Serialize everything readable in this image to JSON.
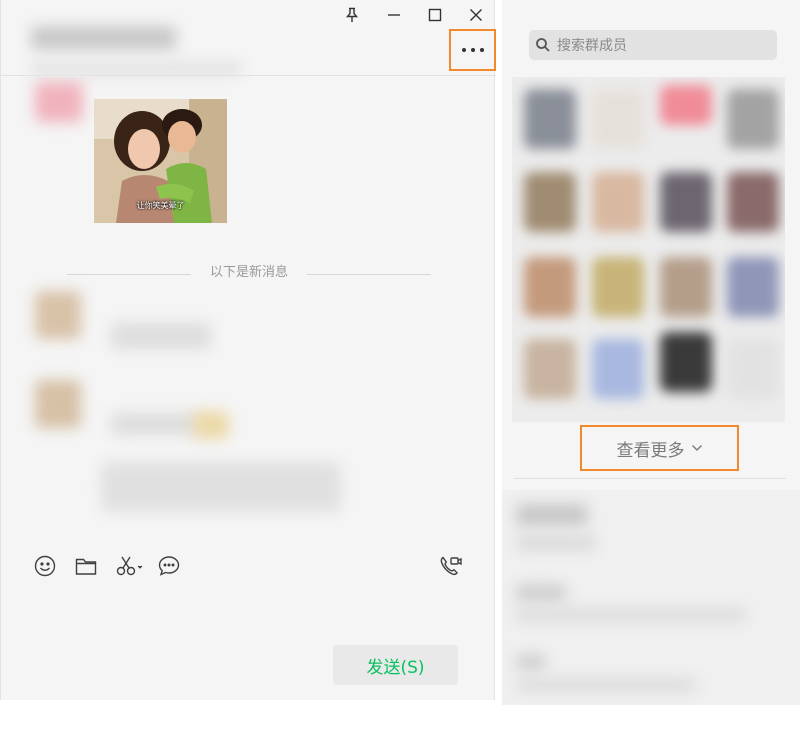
{
  "chat": {
    "divider_text": "以下是新消息",
    "sticker_caption": "让你笑美晕了",
    "send_label": "发送(S)"
  },
  "window_controls": [
    "pin-icon",
    "minimize-icon",
    "maximize-icon",
    "close-icon"
  ],
  "toolbar_icons": [
    "emoji-icon",
    "folder-icon",
    "scissors-icon",
    "chat-bubble-icon",
    "video-call-icon"
  ],
  "side": {
    "search_placeholder": "搜索群成员",
    "see_more_label": "查看更多"
  },
  "colors": {
    "highlight": "#f08a2c",
    "send_text": "#07c160",
    "background": "#f5f5f5"
  }
}
